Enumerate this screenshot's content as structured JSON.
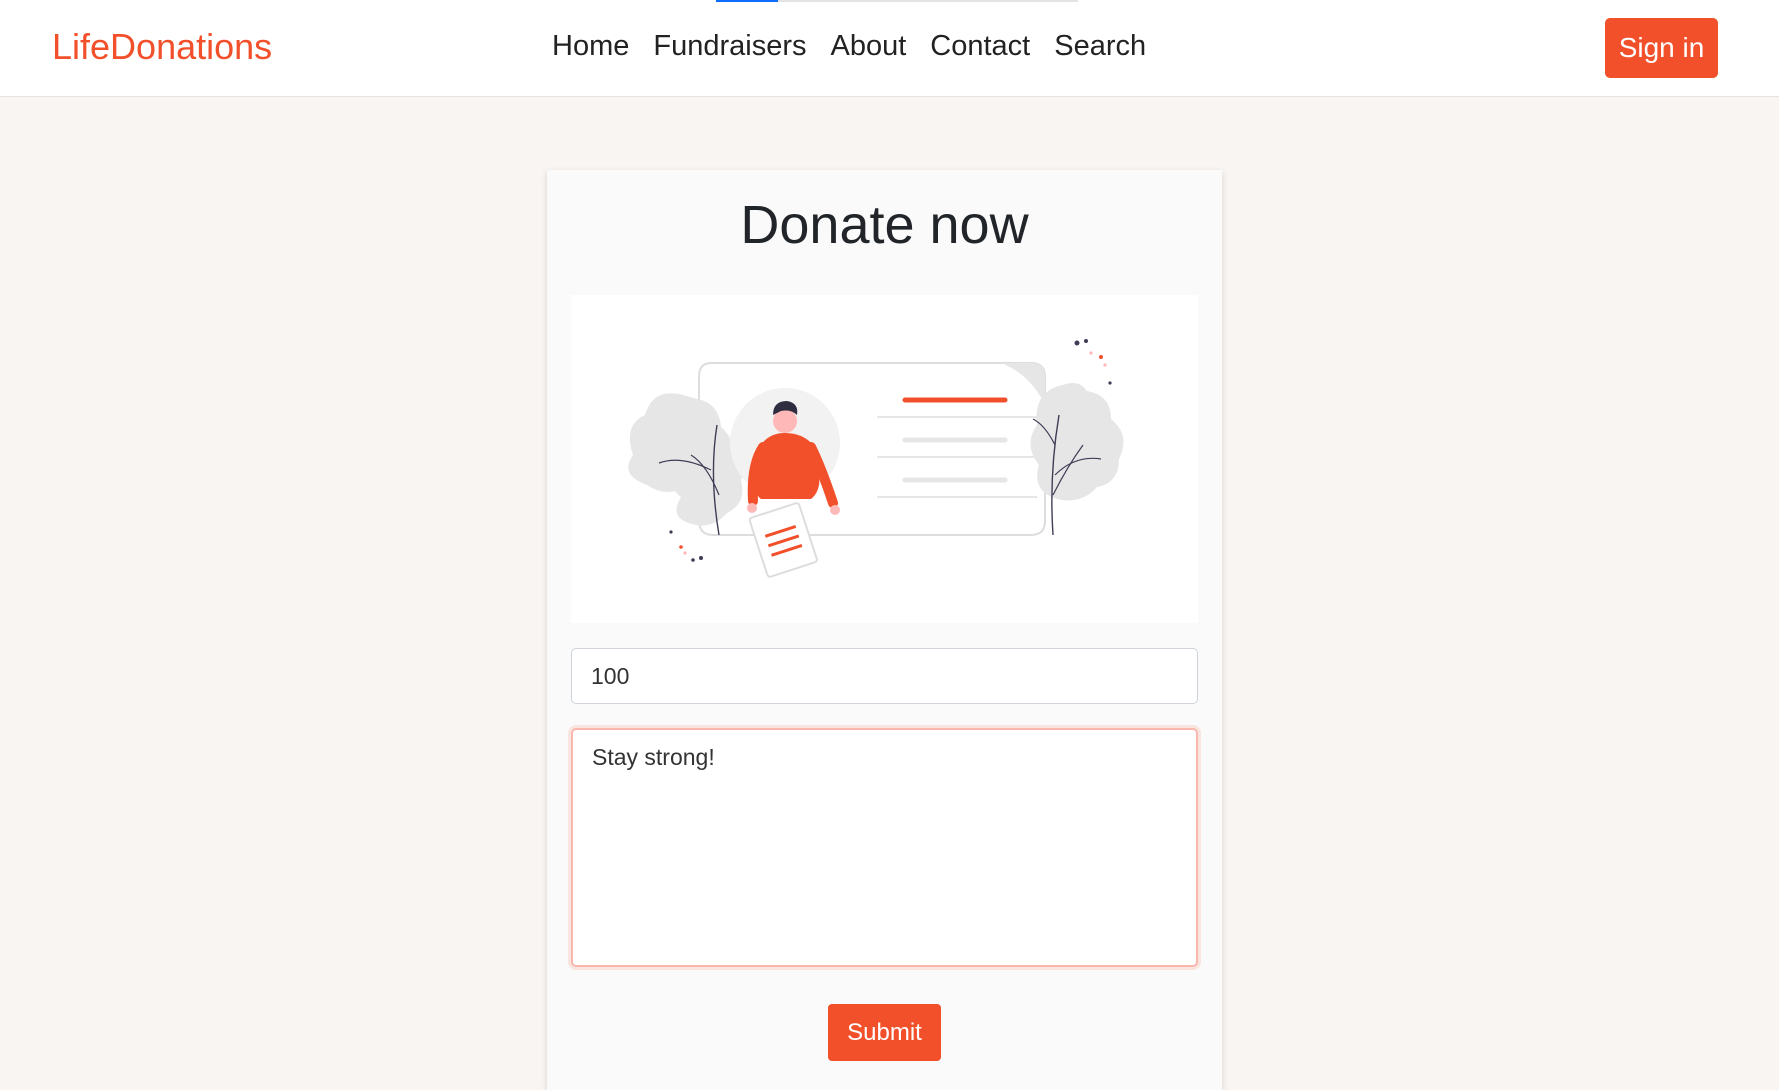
{
  "navbar": {
    "brand": "LifeDonations",
    "progress": 0.17,
    "links": [
      {
        "label": "Home"
      },
      {
        "label": "Fundraisers"
      },
      {
        "label": "About"
      },
      {
        "label": "Contact"
      },
      {
        "label": "Search"
      }
    ],
    "signin_label": "Sign in"
  },
  "donate": {
    "title": "Donate now",
    "amount_value": "100",
    "message_value": "Stay strong!",
    "submit_label": "Submit",
    "illustration_icon": "donation-form-illustration"
  },
  "colors": {
    "accent": "#f1502b",
    "page_background": "#f9f5f2",
    "progress": "#0d6efd"
  }
}
